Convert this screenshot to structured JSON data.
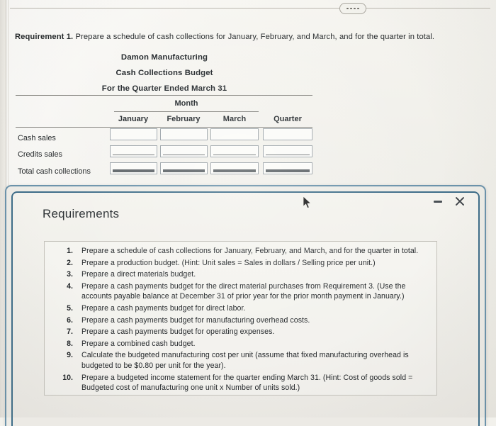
{
  "page": {
    "top_pill_dots": 4
  },
  "requirement_heading": {
    "label": "Requirement 1.",
    "text": "Prepare a schedule of cash collections for January, February, and March, and for the quarter in total."
  },
  "worksheet": {
    "company": "Damon Manufacturing",
    "statement": "Cash Collections Budget",
    "period": "For the Quarter Ended March 31",
    "group_header": "Month",
    "columns": [
      "January",
      "February",
      "March",
      "Quarter"
    ],
    "rows": [
      {
        "label": "Cash sales",
        "values": [
          "",
          "",
          "",
          ""
        ],
        "style": "plain"
      },
      {
        "label": "Credits sales",
        "values": [
          "",
          "",
          "",
          ""
        ],
        "style": "underline"
      },
      {
        "label": "Total cash collections",
        "values": [
          "",
          "",
          "",
          ""
        ],
        "style": "total"
      }
    ]
  },
  "dialog": {
    "title": "Requirements",
    "minimize_label": "Minimize",
    "close_label": "Close",
    "border_color": "#3e6d89",
    "requirements": [
      {
        "num": "1.",
        "text": "Prepare a schedule of cash collections for January, February, and March, and for the quarter in total."
      },
      {
        "num": "2.",
        "text": "Prepare a production budget. (Hint: Unit sales = Sales in dollars / Selling price per unit.)"
      },
      {
        "num": "3.",
        "text": "Prepare a direct materials budget."
      },
      {
        "num": "4.",
        "text": "Prepare a cash payments budget for the direct material purchases from Requirement 3. (Use the accounts payable balance at December 31 of prior year for the prior month payment in January.)"
      },
      {
        "num": "5.",
        "text": "Prepare a cash payments budget for direct labor."
      },
      {
        "num": "6.",
        "text": "Prepare a cash payments budget for manufacturing overhead costs."
      },
      {
        "num": "7.",
        "text": "Prepare a cash payments budget for operating expenses."
      },
      {
        "num": "8.",
        "text": "Prepare a combined cash budget."
      },
      {
        "num": "9.",
        "text": "Calculate the budgeted manufacturing cost per unit (assume that fixed manufacturing overhead is budgeted to be $0.80 per unit for the year)."
      },
      {
        "num": "10.",
        "text": "Prepare a budgeted income statement for the quarter ending March 31. (Hint: Cost of goods sold = Budgeted cost of manufacturing one unit x Number of units sold.)"
      }
    ]
  }
}
